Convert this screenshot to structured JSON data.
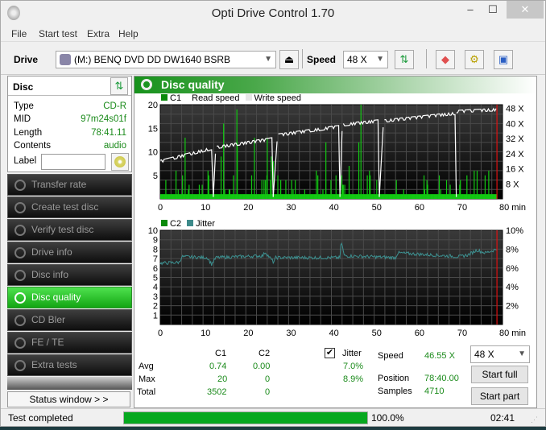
{
  "window": {
    "title": "Opti Drive Control 1.70",
    "minimize": "‒",
    "maximize": "☐",
    "close": "✕"
  },
  "menu": [
    "File",
    "Start test",
    "Extra",
    "Help"
  ],
  "toolbar": {
    "drive_label": "Drive",
    "drive_value": "(M:)   BENQ DVD DD DW1640 BSRB",
    "speed_label": "Speed",
    "speed_value": "48 X"
  },
  "disc": {
    "header": "Disc",
    "fields": [
      {
        "key": "Type",
        "value": "CD-R"
      },
      {
        "key": "MID",
        "value": "97m24s01f"
      },
      {
        "key": "Length",
        "value": "78:41.11"
      },
      {
        "key": "Contents",
        "value": "audio"
      }
    ],
    "label_key": "Label",
    "label_value": ""
  },
  "nav": [
    {
      "label": "Transfer rate",
      "active": false
    },
    {
      "label": "Create test disc",
      "active": false
    },
    {
      "label": "Verify test disc",
      "active": false
    },
    {
      "label": "Drive info",
      "active": false
    },
    {
      "label": "Disc info",
      "active": false
    },
    {
      "label": "Disc quality",
      "active": true
    },
    {
      "label": "CD Bler",
      "active": false
    },
    {
      "label": "FE / TE",
      "active": false
    },
    {
      "label": "Extra tests",
      "active": false
    }
  ],
  "status_window_button": "Status window > >",
  "panel": {
    "title": "Disc quality"
  },
  "chart_data": [
    {
      "type": "bar+line",
      "title": "C1 / Read speed",
      "legend": [
        {
          "name": "C1",
          "color": "#00cc00"
        },
        {
          "name": "Read speed",
          "color": "#ffffff"
        },
        {
          "name": "Write speed",
          "color": "#dddddd"
        }
      ],
      "xlabel": "min",
      "x_ticks": [
        0,
        10,
        20,
        30,
        40,
        50,
        60,
        70,
        80
      ],
      "y_left_ticks": [
        5,
        10,
        15,
        20
      ],
      "y_left_range": [
        0,
        20
      ],
      "y_right_ticks": [
        "8 X",
        "16 X",
        "24 X",
        "32 X",
        "40 X",
        "48 X"
      ],
      "y_right_range": [
        0,
        50
      ],
      "x_range": [
        0,
        80
      ],
      "end_marker_min": 78.7,
      "read_speed_segments": [
        {
          "x": [
            0,
            12.2
          ],
          "y": [
            20.5,
            27.5
          ]
        },
        {
          "x": [
            13.2,
            26.2
          ],
          "y": [
            28,
            32.5
          ]
        },
        {
          "x": [
            27.6,
            41.8
          ],
          "y": [
            34.5,
            39
          ]
        },
        {
          "x": [
            42.8,
            51
          ],
          "y": [
            40,
            42
          ]
        },
        {
          "x": [
            52.4,
            69
          ],
          "y": [
            42,
            46
          ]
        },
        {
          "x": [
            69.2,
            78.7
          ],
          "y": [
            47,
            48
          ]
        }
      ],
      "c1_peaks": [
        {
          "x": 5.7,
          "y": 13
        },
        {
          "x": 14.7,
          "y": 16
        },
        {
          "x": 17.8,
          "y": 19
        },
        {
          "x": 17.9,
          "y": 12
        },
        {
          "x": 21.9,
          "y": 13
        },
        {
          "x": 24.9,
          "y": 13
        },
        {
          "x": 38.6,
          "y": 12
        },
        {
          "x": 46.8,
          "y": 20
        },
        {
          "x": 46.3,
          "y": 12
        }
      ]
    },
    {
      "type": "line",
      "title": "C2 / Jitter",
      "legend": [
        {
          "name": "C2",
          "color": "#00aa00"
        },
        {
          "name": "Jitter",
          "color": "#3d8a8a"
        }
      ],
      "xlabel": "min",
      "x_ticks": [
        0,
        10,
        20,
        30,
        40,
        50,
        60,
        70,
        80
      ],
      "y_left_ticks": [
        1,
        2,
        3,
        4,
        5,
        6,
        7,
        8,
        9,
        10
      ],
      "y_left_range": [
        0,
        10
      ],
      "y_right_ticks": [
        "2%",
        "4%",
        "6%",
        "8%",
        "10%"
      ],
      "y_right_range": [
        0,
        10
      ],
      "x_range": [
        0,
        80
      ],
      "end_marker_min": 78.7,
      "jitter_keypoints": [
        [
          0,
          6.5
        ],
        [
          4.5,
          6.6
        ],
        [
          5,
          7.2
        ],
        [
          11,
          7.1
        ],
        [
          12,
          6.4
        ],
        [
          13,
          7.1
        ],
        [
          24,
          7.3
        ],
        [
          24.5,
          7.7
        ],
        [
          26.5,
          6.6
        ],
        [
          27,
          7.1
        ],
        [
          42,
          7.1
        ],
        [
          42.3,
          8.9
        ],
        [
          43,
          7.3
        ],
        [
          55,
          7.1
        ],
        [
          55.5,
          7.6
        ],
        [
          70,
          7.2
        ],
        [
          72,
          7.4
        ],
        [
          74,
          7.9
        ],
        [
          76,
          7.6
        ],
        [
          78.7,
          8
        ]
      ],
      "c2_values": 0
    }
  ],
  "stats": {
    "col_c1": "C1",
    "col_c2": "C2",
    "jitter_label": "Jitter",
    "jitter_checked": true,
    "rows": [
      {
        "label": "Avg",
        "c1": "0.74",
        "c2": "0.00",
        "jitter": "7.0%"
      },
      {
        "label": "Max",
        "c1": "20",
        "c2": "0",
        "jitter": "8.9%"
      },
      {
        "label": "Total",
        "c1": "3502",
        "c2": "0",
        "jitter": ""
      }
    ],
    "speed_label": "Speed",
    "speed_value": "46.55 X",
    "position_label": "Position",
    "position_value": "78:40.00",
    "samples_label": "Samples",
    "samples_value": "4710",
    "speed_select": "48 X",
    "start_full": "Start full",
    "start_part": "Start part"
  },
  "statusbar": {
    "text": "Test completed",
    "progress": 100,
    "progress_text": "100.0%",
    "time": "02:41"
  }
}
